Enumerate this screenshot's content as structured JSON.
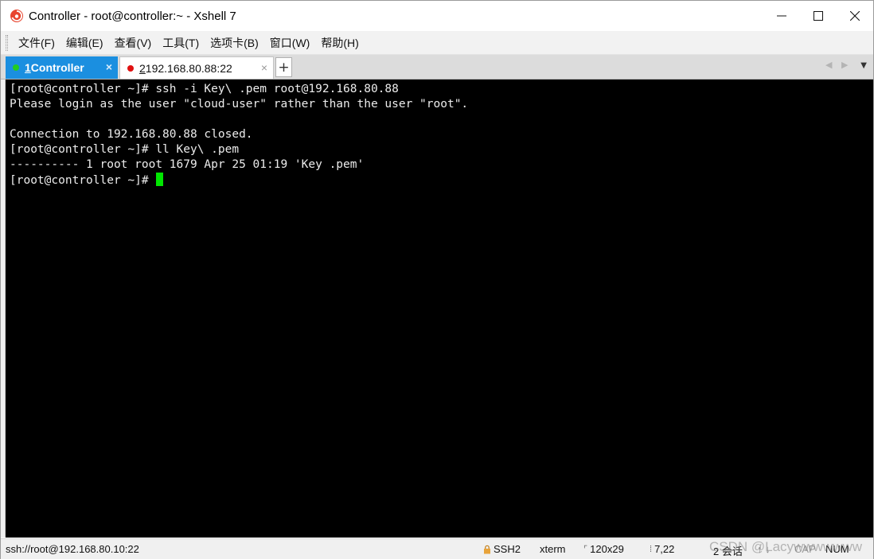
{
  "window": {
    "title": "Controller - root@controller:~ - Xshell 7",
    "minimize_glyph": "—",
    "maximize_glyph": "☐",
    "close_glyph": "✕"
  },
  "menu": [
    "文件(F)",
    "编辑(E)",
    "查看(V)",
    "工具(T)",
    "选项卡(B)",
    "窗口(W)",
    "帮助(H)"
  ],
  "tabs": [
    {
      "number": "1",
      "label": " Controller",
      "status_color": "#22cc22",
      "active": true
    },
    {
      "number": "2",
      "label": " 192.168.80.88:22",
      "status_color": "#e01010",
      "active": false
    }
  ],
  "tab_close_glyph": "×",
  "tab_add_glyph": "+",
  "terminal": {
    "lines": [
      "[root@controller ~]# ssh -i Key\\ .pem root@192.168.80.88",
      "Please login as the user \"cloud-user\" rather than the user \"root\".",
      "",
      "Connection to 192.168.80.88 closed.",
      "[root@controller ~]# ll Key\\ .pem",
      "---------- 1 root root 1679 Apr 25 01:19 'Key .pem'",
      "[root@controller ~]# "
    ],
    "cursor_color": "#00e600"
  },
  "status": {
    "connection": "ssh://root@192.168.80.10:22",
    "protocol": "SSH2",
    "terminal_type": "xterm",
    "size": "120x29",
    "cursor_pos": "7,22",
    "sessions": "2 会话",
    "caps": "CAP",
    "num": "NUM"
  },
  "watermark": "CSDN @Lacywwwwwww",
  "icons": {
    "app": "xshell-logo-icon",
    "lock": "lock-icon"
  }
}
